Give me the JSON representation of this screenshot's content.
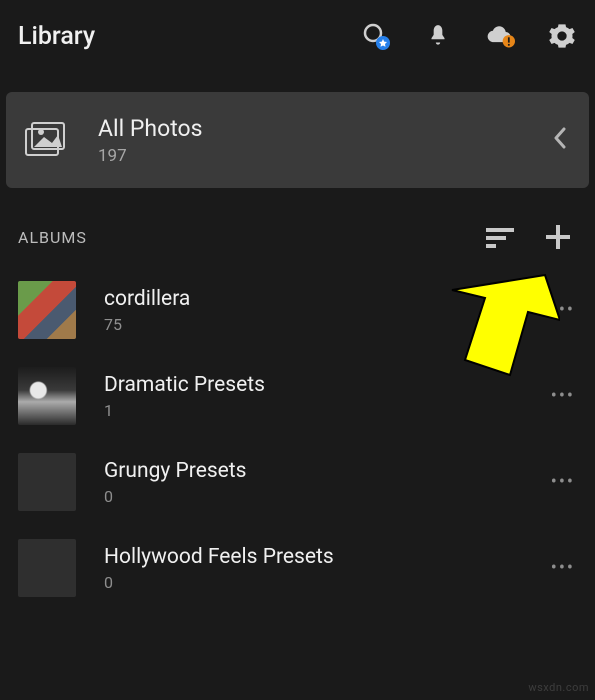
{
  "header": {
    "title": "Library",
    "icons": {
      "search": "search-icon",
      "notifications": "bell-icon",
      "cloud": "cloud-alert-icon",
      "settings": "gear-icon"
    }
  },
  "all_photos": {
    "title": "All Photos",
    "count": "197"
  },
  "albums_section": {
    "label": "ALBUMS",
    "sort": "sort",
    "add": "add"
  },
  "albums": [
    {
      "name": "cordillera",
      "count": "75",
      "thumb": "cordillera"
    },
    {
      "name": "Dramatic Presets",
      "count": "1",
      "thumb": "dramatic"
    },
    {
      "name": "Grungy Presets",
      "count": "0",
      "thumb": "empty"
    },
    {
      "name": "Hollywood Feels Presets",
      "count": "0",
      "thumb": "empty"
    }
  ],
  "colors": {
    "accent_blue": "#2680eb",
    "alert_orange": "#e68619",
    "annotation_yellow": "#ffff00"
  },
  "watermark": "wsxdn.com"
}
